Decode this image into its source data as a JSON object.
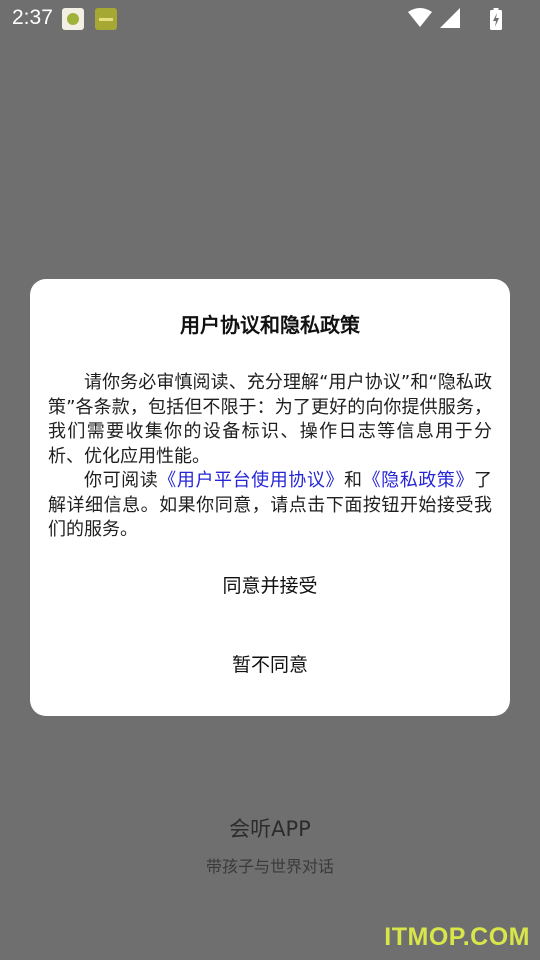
{
  "status_bar": {
    "time": "2:37",
    "icons": [
      "app-notification-icon",
      "app-notification-icon",
      "wifi-icon",
      "cellular-signal-icon",
      "battery-charging-icon"
    ]
  },
  "background": {
    "app_name": "会听APP",
    "slogan": "带孩子与世界对话",
    "watermark": "ITMOP.COM"
  },
  "dialog": {
    "title": "用户协议和隐私政策",
    "paragraph1": "请你务必审慎阅读、充分理解“用户协议”和“隐私政策”各条款，包括但不限于：为了更好的向你提供服务，我们需要收集你的设备标识、操作日志等信息用于分析、优化应用性能。",
    "paragraph2_prefix": "你可阅读",
    "user_agreement_link": "《用户平台使用协议》",
    "paragraph2_and": "和",
    "privacy_policy_link": "《隐私政策》",
    "paragraph2_suffix": "了解详细信息。如果你同意，请点击下面按钮开始接受我们的服务。",
    "accept_label": "同意并接受",
    "decline_label": "暂不同意"
  },
  "colors": {
    "overlay": "#6f6f6f",
    "dialog_background": "#ffffff",
    "link": "#2626d8",
    "watermark": "#d8e64a"
  }
}
